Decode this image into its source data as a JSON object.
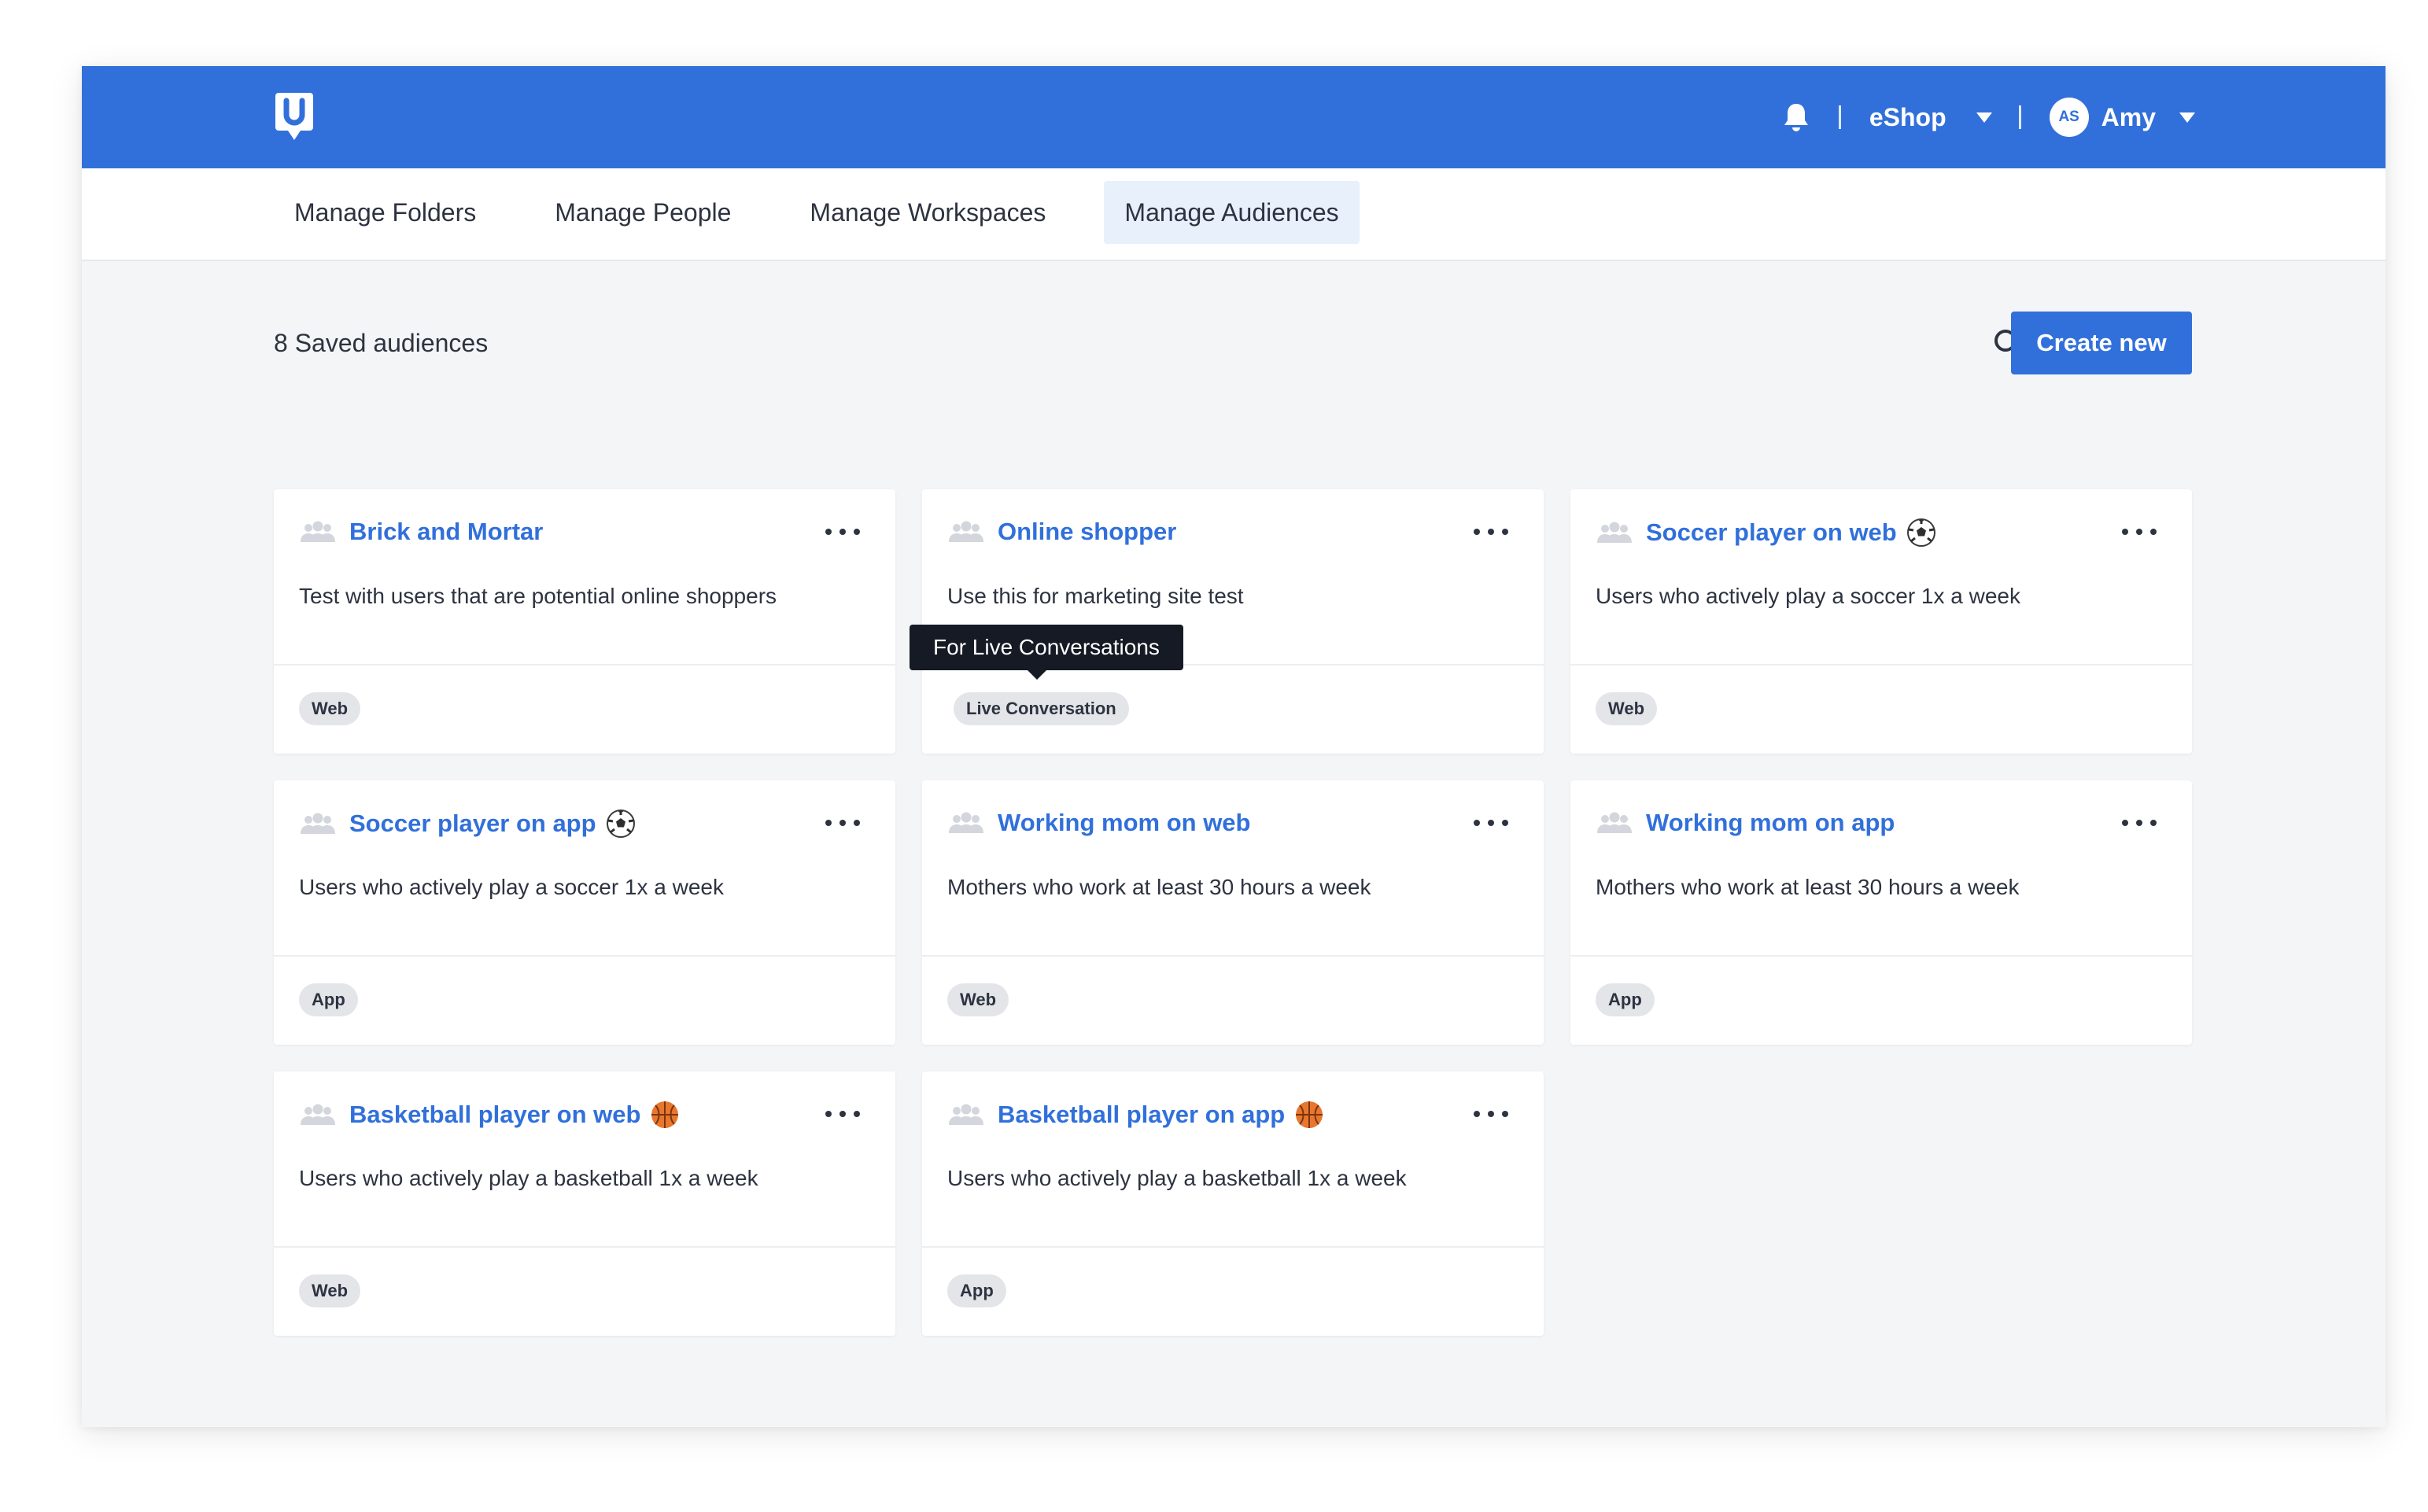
{
  "header": {
    "workspace_name": "eShop",
    "user_initials": "AS",
    "user_name": "Amy",
    "brand_color": "#3170db"
  },
  "tabs": [
    {
      "label": "Manage Folders",
      "active": false
    },
    {
      "label": "Manage People",
      "active": false
    },
    {
      "label": "Manage Workspaces",
      "active": false
    },
    {
      "label": "Manage Audiences",
      "active": true
    }
  ],
  "toolbar": {
    "saved_count_label": "8 Saved audiences",
    "create_button_label": "Create new"
  },
  "audiences": [
    {
      "title": "Brick and Mortar",
      "emoji": "",
      "description": "Test with users that are potential online shoppers",
      "tag": "Web"
    },
    {
      "title": "Online shopper",
      "emoji": "",
      "description": "Use this for marketing site test",
      "tag": "Live Conversation",
      "tooltip": "For Live Conversations"
    },
    {
      "title": "Soccer player on web",
      "emoji": "soccer-ball-icon",
      "description": "Users who actively play a soccer 1x a week",
      "tag": "Web"
    },
    {
      "title": "Soccer player on app",
      "emoji": "soccer-ball-icon",
      "description": "Users who actively play a soccer 1x a week",
      "tag": "App"
    },
    {
      "title": "Working mom on web",
      "emoji": "",
      "description": "Mothers who work at least 30 hours a week",
      "tag": "Web"
    },
    {
      "title": "Working mom on app",
      "emoji": "",
      "description": "Mothers who work at least 30 hours a week",
      "tag": "App"
    },
    {
      "title": "Basketball player on web",
      "emoji": "basketball-icon",
      "description": "Users who actively play a basketball 1x a week",
      "tag": "Web"
    },
    {
      "title": "Basketball player on app",
      "emoji": "basketball-icon",
      "description": "Users who actively play a basketball 1x a week",
      "tag": "App"
    }
  ]
}
